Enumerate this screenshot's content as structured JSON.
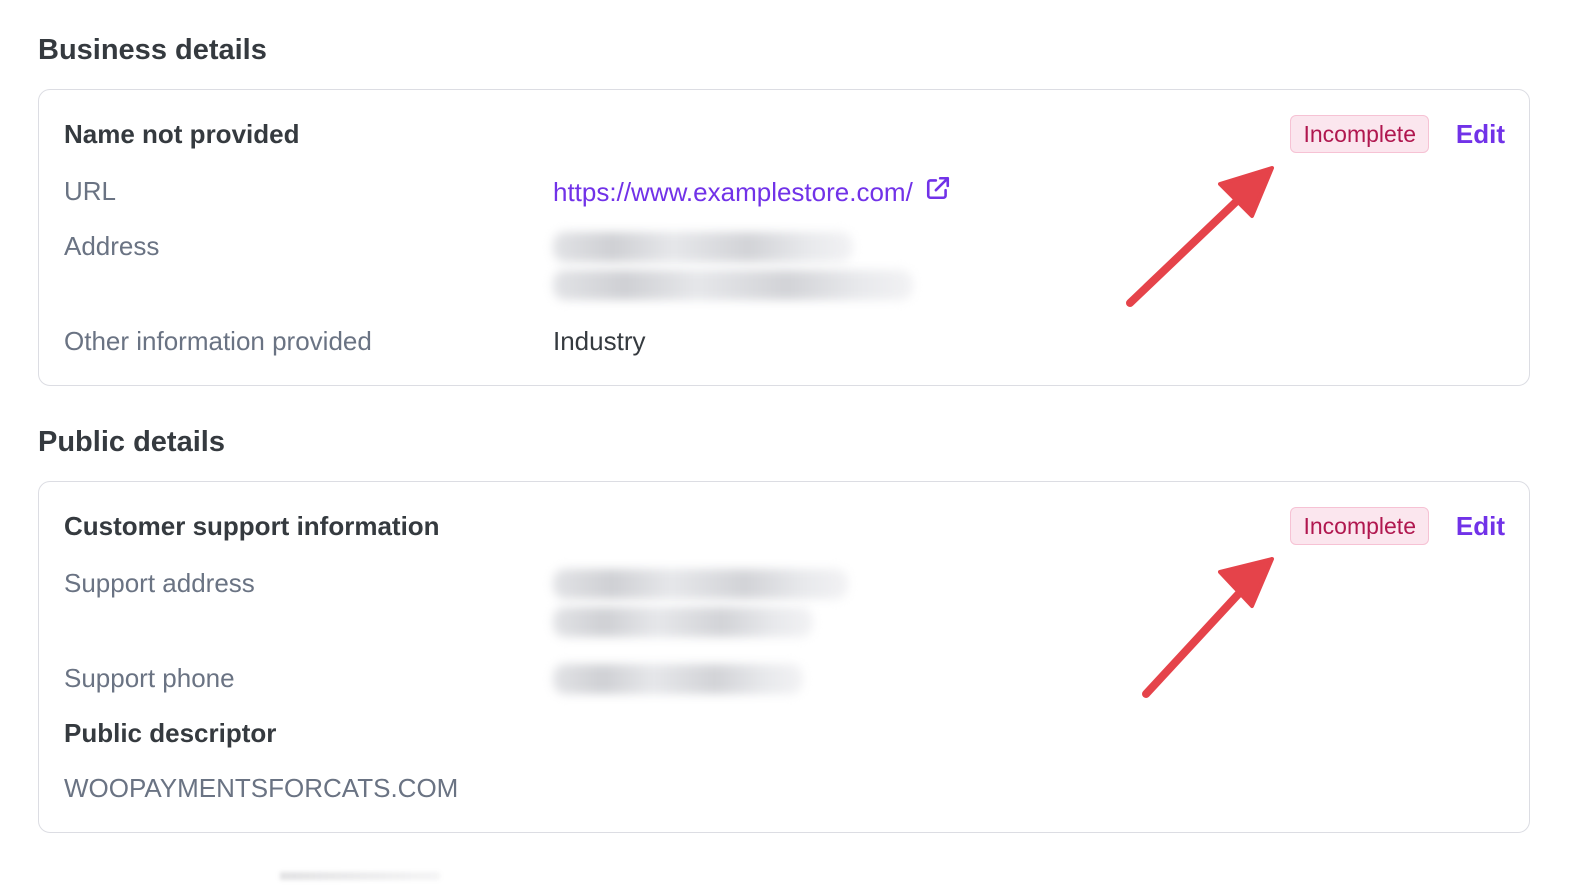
{
  "business_details": {
    "section_title": "Business details",
    "card_title": "Name not provided",
    "status": "Incomplete",
    "edit_label": "Edit",
    "rows": {
      "url_label": "URL",
      "url_value": "https://www.examplestore.com/",
      "address_label": "Address",
      "other_label": "Other information provided",
      "other_value": "Industry"
    }
  },
  "public_details": {
    "section_title": "Public details",
    "card_title": "Customer support information",
    "status": "Incomplete",
    "edit_label": "Edit",
    "rows": {
      "support_address_label": "Support address",
      "support_phone_label": "Support phone",
      "descriptor_title": "Public descriptor",
      "descriptor_value": "WOOPAYMENTSFORCATS.COM"
    }
  },
  "icons": {
    "external_link": "external-link-icon",
    "annotation_arrow": "red-arrow-icon"
  },
  "colors": {
    "accent": "#7132e8",
    "badge_bg": "#fbe6ee",
    "badge_text": "#b0174f",
    "annotation": "#e5434a"
  }
}
